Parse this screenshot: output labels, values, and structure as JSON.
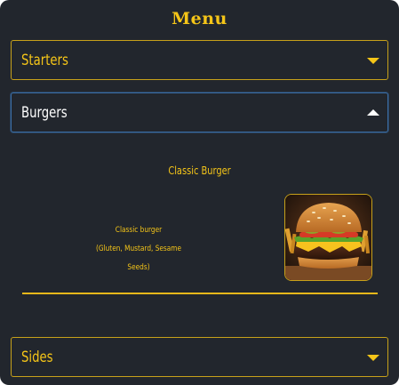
{
  "menu": {
    "title": "Menu",
    "sections": [
      {
        "label": "Starters",
        "expanded": false
      },
      {
        "label": "Burgers",
        "expanded": true
      },
      {
        "label": "Sides",
        "expanded": false
      }
    ],
    "burgers": {
      "items": [
        {
          "name": "Classic Burger",
          "description": "Classic burger",
          "allergens": "(Gluten, Mustard, Sesame Seeds)"
        }
      ]
    }
  },
  "colors": {
    "background": "#22262d",
    "accent": "#f5c518",
    "border": "#c7a11a",
    "focus": "#3a6fa8"
  },
  "icons": {
    "collapsed": "caret-down-icon",
    "expanded": "caret-up-icon"
  }
}
